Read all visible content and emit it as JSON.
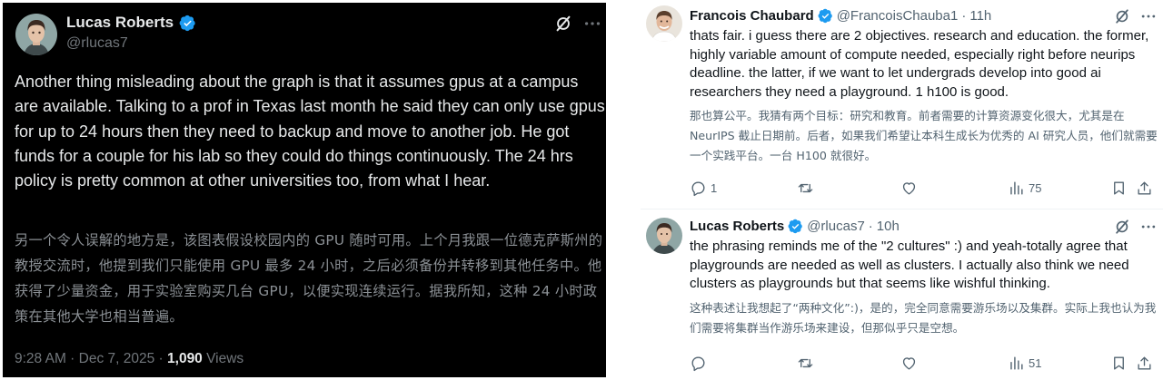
{
  "left_post": {
    "author_name": "Lucas Roberts",
    "author_handle": "@rlucas7",
    "text_en": "Another thing misleading about the graph is that it assumes gpus at a campus are available. Talking to a prof in Texas last month he said they can only use gpus for up to 24 hours then they need to backup and move to another job. He got funds for a couple for his lab so they could do things continuously. The 24 hrs policy is pretty common at other universities too, from what I hear.",
    "text_zh": "另一个令人误解的地方是，该图表假设校园内的 GPU 随时可用。上个月我跟一位德克萨斯州的教授交流时，他提到我们只能使用 GPU 最多 24 小时，之后必须备份并转移到其他任务中。他获得了少量资金，用于实验室购买几台 GPU，以便实现连续运行。据我所知，这种 24 小时政策在其他大学也相当普遍。",
    "timestamp": "9:28 AM · Dec 7, 2025 · ",
    "views_count": "1,090",
    "views_label": " Views",
    "icons": [
      "verified-badge-icon",
      "grok-icon",
      "more-icon"
    ],
    "colors": {
      "background": "#000000",
      "text": "#e7e9ea",
      "muted": "#71767b",
      "verified": "#1d9bf0"
    }
  },
  "right_thread": {
    "posts": [
      {
        "author_name": "Francois Chaubard",
        "author_handle": "@FrancoisChauba1",
        "time": "11h",
        "text_en": "thats fair. i guess there are 2 objectives. research and education. the former, highly variable amount of compute needed, especially right before neurips deadline. the latter, if we want to let undergrads develop into good ai researchers they need a playground. 1 h100 is good.",
        "text_zh": "那也算公平。我猜有两个目标：研究和教育。前者需要的计算资源变化很大，尤其是在 NeurIPS 截止日期前。后者，如果我们希望让本科生成长为优秀的 AI 研究人员，他们就需要一个实践平台。一台 H100 就很好。",
        "reply_count": "1",
        "repost_count": "",
        "like_count": "",
        "view_count": "75"
      },
      {
        "author_name": "Lucas Roberts",
        "author_handle": "@rlucas7",
        "time": "10h",
        "text_en": "the phrasing reminds me of the \"2 cultures\" :) and yeah-totally agree that playgrounds are needed as well as clusters. I actually also think we need clusters as playgrounds but that seems like wishful thinking.",
        "text_zh": "这种表述让我想起了“两种文化”:)，是的，完全同意需要游乐场以及集群。实际上我也认为我们需要将集群当作游乐场来建设，但那似乎只是空想。",
        "reply_count": "",
        "repost_count": "",
        "like_count": "",
        "view_count": "51"
      }
    ],
    "separator": "·",
    "icons": [
      "reply-icon",
      "repost-icon",
      "like-icon",
      "views-icon",
      "bookmark-icon",
      "share-icon"
    ],
    "colors": {
      "background": "#ffffff",
      "text": "#0f1419",
      "muted": "#536471",
      "verified": "#1d9bf0"
    }
  }
}
